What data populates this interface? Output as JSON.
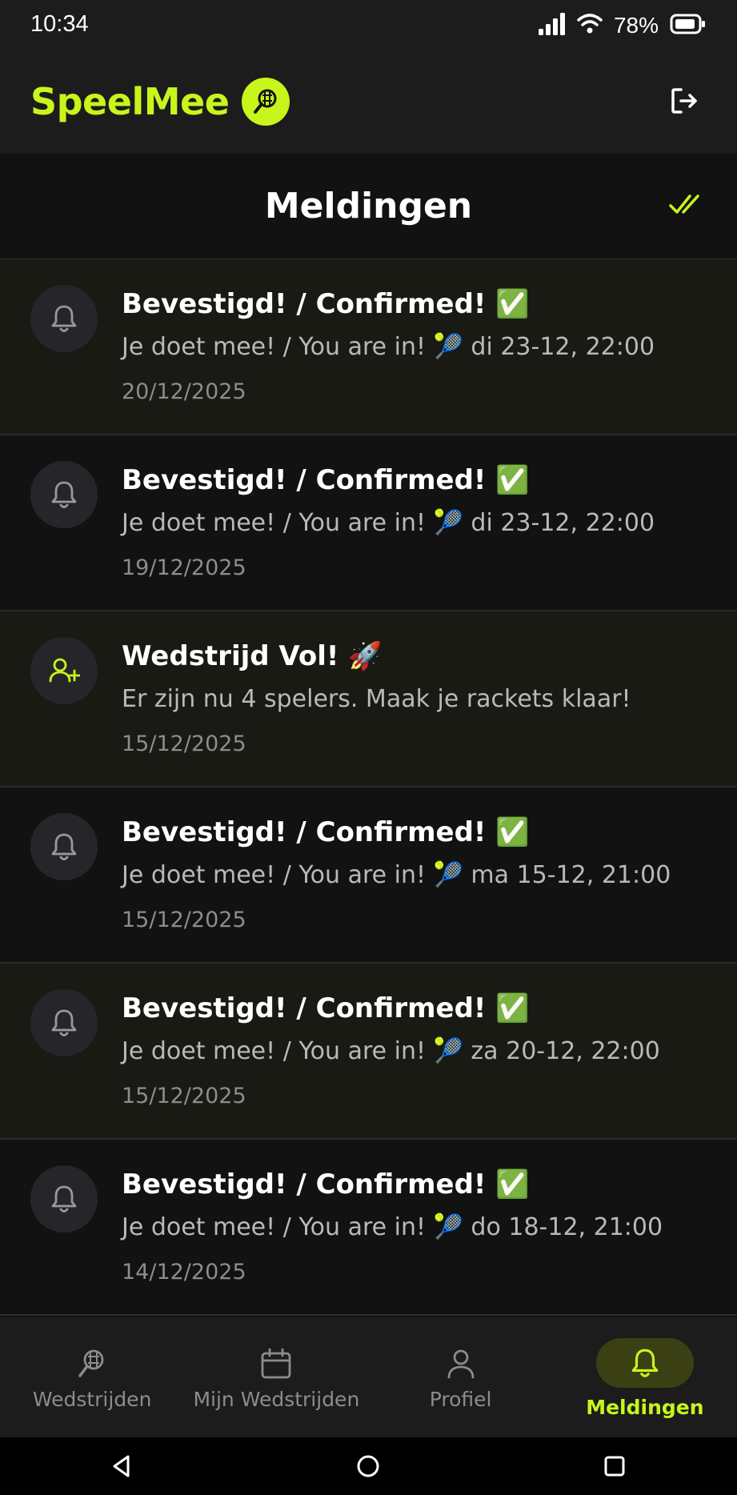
{
  "status_bar": {
    "time": "10:34",
    "battery": "78%",
    "icons": [
      "signal-icon",
      "wifi-icon",
      "battery-icon"
    ]
  },
  "header": {
    "app_name": "SpeelMee",
    "logo_icon": "padel-ball-racket-icon",
    "logout_icon": "logout-icon",
    "brand_color": "#c8f51b"
  },
  "page": {
    "title": "Meldingen",
    "mark_all_read_icon": "double-check-icon"
  },
  "notifications": [
    {
      "icon": "bell-icon",
      "unread": true,
      "title": "Bevestigd! / Confirmed! ✅",
      "body": "Je doet mee! / You are in! 🎾 di 23-12, 22:00",
      "date": "20/12/2025"
    },
    {
      "icon": "bell-icon",
      "unread": false,
      "title": "Bevestigd! / Confirmed! ✅",
      "body": "Je doet mee! / You are in! 🎾 di 23-12, 22:00",
      "date": "19/12/2025"
    },
    {
      "icon": "user-plus-icon",
      "unread": true,
      "title": "Wedstrijd Vol! 🚀",
      "body": "Er zijn nu 4 spelers. Maak je rackets klaar!",
      "date": "15/12/2025"
    },
    {
      "icon": "bell-icon",
      "unread": false,
      "title": "Bevestigd! / Confirmed! ✅",
      "body": "Je doet mee! / You are in! 🎾 ma 15-12, 21:00",
      "date": "15/12/2025"
    },
    {
      "icon": "bell-icon",
      "unread": true,
      "title": "Bevestigd! / Confirmed! ✅",
      "body": "Je doet mee! / You are in! 🎾 za 20-12, 22:00",
      "date": "15/12/2025"
    },
    {
      "icon": "bell-icon",
      "unread": false,
      "title": "Bevestigd! / Confirmed! ✅",
      "body": "Je doet mee! / You are in! 🎾 do 18-12, 21:00",
      "date": "14/12/2025"
    }
  ],
  "bottom_nav": [
    {
      "label": "Wedstrijden",
      "icon": "padel-racket-icon",
      "active": false
    },
    {
      "label": "Mijn Wedstrijden",
      "icon": "calendar-icon",
      "active": false
    },
    {
      "label": "Profiel",
      "icon": "user-icon",
      "active": false
    },
    {
      "label": "Meldingen",
      "icon": "bell-icon",
      "active": true
    }
  ],
  "system_nav": {
    "icons": [
      "back-icon",
      "home-icon",
      "recents-icon"
    ]
  },
  "colors": {
    "accent": "#c8f51b",
    "background": "#121212",
    "surface": "#1c1c1c",
    "unread_row": "#191a14",
    "muted_text": "#b9b9b9"
  }
}
